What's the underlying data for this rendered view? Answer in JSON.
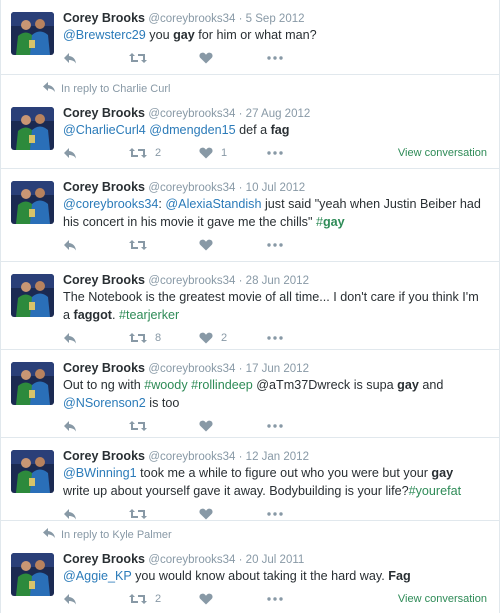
{
  "colors": {
    "link": "#2b7bb9",
    "hashtag": "#2e8b57",
    "muted": "#8899a6",
    "text": "#292f33",
    "divider": "#e1e8ed"
  },
  "icons": [
    "avatar",
    "reply-icon",
    "retweet-icon",
    "like-icon",
    "more-icon",
    "reply-context-arrow-icon"
  ],
  "tweets": [
    {
      "name": "Corey Brooks",
      "handle": "@coreybrooks34",
      "date": "5 Sep 2012",
      "reply_to": "",
      "parts": [
        {
          "t": "link",
          "v": "@Brewsterc29"
        },
        {
          "t": "text",
          "v": " you "
        },
        {
          "t": "bold",
          "v": "gay"
        },
        {
          "t": "text",
          "v": " for him or what man?"
        }
      ],
      "retweets": "",
      "likes": "",
      "view_conversation": ""
    },
    {
      "name": "Corey Brooks",
      "handle": "@coreybrooks34",
      "date": "27 Aug 2012",
      "reply_to": "In reply to Charlie Curl",
      "parts": [
        {
          "t": "link",
          "v": "@CharlieCurl4"
        },
        {
          "t": "text",
          "v": " "
        },
        {
          "t": "link",
          "v": "@dmengden15"
        },
        {
          "t": "text",
          "v": " def a "
        },
        {
          "t": "bold",
          "v": "fag"
        }
      ],
      "retweets": "2",
      "likes": "1",
      "view_conversation": "View conversation"
    },
    {
      "name": "Corey Brooks",
      "handle": "@coreybrooks34",
      "date": "10 Jul 2012",
      "reply_to": "",
      "parts": [
        {
          "t": "link",
          "v": "@coreybrooks34"
        },
        {
          "t": "text",
          "v": ": "
        },
        {
          "t": "link",
          "v": "@AlexiaStandish"
        },
        {
          "t": "text",
          "v": " just said \"yeah when Justin Beiber had his concert in his movie it gave me the chills\" "
        },
        {
          "t": "hash",
          "v": "#"
        },
        {
          "t": "hashbold",
          "v": "gay"
        }
      ],
      "retweets": "",
      "likes": "",
      "view_conversation": ""
    },
    {
      "name": "Corey Brooks",
      "handle": "@coreybrooks34",
      "date": "28 Jun 2012",
      "reply_to": "",
      "parts": [
        {
          "t": "text",
          "v": "The Notebook is the greatest movie of all time... I don't care if you think I'm a "
        },
        {
          "t": "bold",
          "v": "faggot"
        },
        {
          "t": "text",
          "v": ". "
        },
        {
          "t": "hash",
          "v": "#tearjerker"
        }
      ],
      "retweets": "8",
      "likes": "2",
      "view_conversation": ""
    },
    {
      "name": "Corey Brooks",
      "handle": "@coreybrooks34",
      "date": "17 Jun 2012",
      "reply_to": "",
      "parts": [
        {
          "t": "text",
          "v": "Out to ng with "
        },
        {
          "t": "hash",
          "v": "#woody"
        },
        {
          "t": "text",
          "v": " "
        },
        {
          "t": "hash",
          "v": "#rollindeep"
        },
        {
          "t": "text",
          "v": " @aTm37Dwreck is supa "
        },
        {
          "t": "bold",
          "v": "gay"
        },
        {
          "t": "text",
          "v": " and "
        },
        {
          "t": "link",
          "v": "@NSorenson2"
        },
        {
          "t": "text",
          "v": " is too"
        }
      ],
      "retweets": "",
      "likes": "",
      "view_conversation": ""
    },
    {
      "name": "Corey Brooks",
      "handle": "@coreybrooks34",
      "date": "12 Jan 2012",
      "reply_to": "",
      "parts": [
        {
          "t": "link",
          "v": "@BWinning1"
        },
        {
          "t": "text",
          "v": " took me a while to figure out who you were but your "
        },
        {
          "t": "bold",
          "v": "gay"
        },
        {
          "t": "text",
          "v": " write up about yourself gave it away. Bodybuilding is your life?"
        },
        {
          "t": "hash",
          "v": "#yourefat"
        }
      ],
      "retweets": "",
      "likes": "",
      "view_conversation": ""
    },
    {
      "name": "Corey Brooks",
      "handle": "@coreybrooks34",
      "date": "20 Jul 2011",
      "reply_to": "In reply to Kyle Palmer",
      "parts": [
        {
          "t": "link",
          "v": "@Aggie_KP"
        },
        {
          "t": "text",
          "v": " you would know about taking it the hard way. "
        },
        {
          "t": "bold",
          "v": "Fag"
        }
      ],
      "retweets": "2",
      "likes": "",
      "view_conversation": "View conversation"
    }
  ]
}
